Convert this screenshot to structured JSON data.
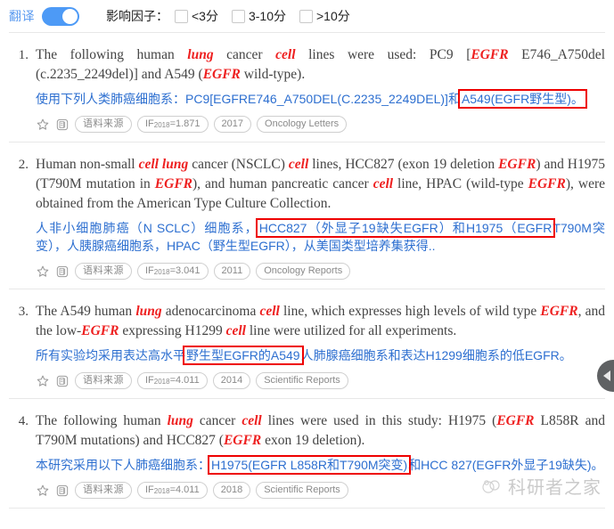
{
  "toolbar": {
    "translate_label": "翻译",
    "translate_on": true,
    "impact_factor_label": "影响因子：",
    "filters": [
      {
        "label": "<3分",
        "checked": false
      },
      {
        "label": "3-10分",
        "checked": false
      },
      {
        "label": ">10分",
        "checked": false
      }
    ]
  },
  "icons": {
    "star": "star-icon",
    "copy": "copy-document-icon",
    "collapse": "chevron-left-icon"
  },
  "chip_labels": {
    "source": "语料来源"
  },
  "colors": {
    "accent_blue": "#4d9af6",
    "translation_blue": "#2d6fd0",
    "keyword_red": "#ee2020",
    "highlight_red": "#ee0000",
    "chip_gray": "#8a8a8a",
    "source_text": "#444444"
  },
  "watermark": {
    "text": "科研者之家"
  },
  "results": [
    {
      "num": "1.",
      "source_parts": [
        {
          "t": "The following human ",
          "kw": false
        },
        {
          "t": "lung",
          "kw": true
        },
        {
          "t": " cancer ",
          "kw": false
        },
        {
          "t": "cell",
          "kw": true
        },
        {
          "t": " lines were used: PC9 [",
          "kw": false
        },
        {
          "t": "EGFR",
          "kw": true
        },
        {
          "t": " E746_A750del (c.2235_2249del)] and A549 (",
          "kw": false
        },
        {
          "t": "EGFR",
          "kw": true
        },
        {
          "t": " wild-type).",
          "kw": false
        }
      ],
      "translation_parts": [
        {
          "t": "使用下列人类肺癌细胞系：PC9[EGFRE746_A750DEL(C.2235_2249DEL)]和",
          "hl": false
        },
        {
          "t": "A549(EGFR野生型)。",
          "hl": true
        }
      ],
      "chips": {
        "impact_prefix": "IF",
        "impact_year": "2018",
        "impact_value": "=1.871",
        "year": "2017",
        "journal": "Oncology Letters"
      }
    },
    {
      "num": "2.",
      "source_parts": [
        {
          "t": "Human non-small ",
          "kw": false
        },
        {
          "t": "cell lung",
          "kw": true
        },
        {
          "t": " cancer (NSCLC) ",
          "kw": false
        },
        {
          "t": "cell",
          "kw": true
        },
        {
          "t": " lines, HCC827 (exon 19 deletion ",
          "kw": false
        },
        {
          "t": "EGFR",
          "kw": true
        },
        {
          "t": ") and H1975 (T790M mutation in ",
          "kw": false
        },
        {
          "t": "EGFR",
          "kw": true
        },
        {
          "t": "), and human pancreatic cancer ",
          "kw": false
        },
        {
          "t": "cell",
          "kw": true
        },
        {
          "t": " line, HPAC (wild-type ",
          "kw": false
        },
        {
          "t": "EGFR",
          "kw": true
        },
        {
          "t": "), were obtained from the American Type Culture Collection.",
          "kw": false
        }
      ],
      "translation_parts": [
        {
          "t": "人非小细胞肺癌（N SCLC）细胞系，",
          "hl": false
        },
        {
          "t": "HCC827（外显子19缺失EGFR）和H1975（EGFR",
          "hl": true
        },
        {
          "t": "T790M突变），人胰腺癌细胞系，HPAC（野生型EGFR），从美国类型培养集获得..",
          "hl": false
        }
      ],
      "chips": {
        "impact_prefix": "IF",
        "impact_year": "2018",
        "impact_value": "=3.041",
        "year": "2011",
        "journal": "Oncology Reports"
      }
    },
    {
      "num": "3.",
      "source_parts": [
        {
          "t": "The A549 human ",
          "kw": false
        },
        {
          "t": "lung",
          "kw": true
        },
        {
          "t": " adenocarcinoma ",
          "kw": false
        },
        {
          "t": "cell",
          "kw": true
        },
        {
          "t": " line, which expresses high levels of wild type ",
          "kw": false
        },
        {
          "t": "EGFR",
          "kw": true
        },
        {
          "t": ", and the low-",
          "kw": false
        },
        {
          "t": "EGFR",
          "kw": true
        },
        {
          "t": " expressing H1299 ",
          "kw": false
        },
        {
          "t": "cell",
          "kw": true
        },
        {
          "t": " line were utilized for all experiments.",
          "kw": false
        }
      ],
      "translation_parts": [
        {
          "t": "所有实验均采用表达高水平",
          "hl": false
        },
        {
          "t": "野生型EGFR的A549",
          "hl": true
        },
        {
          "t": "人肺腺癌细胞系和表达H1299细胞系的低EGFR。",
          "hl": false
        }
      ],
      "chips": {
        "impact_prefix": "IF",
        "impact_year": "2018",
        "impact_value": "=4.011",
        "year": "2014",
        "journal": "Scientific Reports"
      }
    },
    {
      "num": "4.",
      "source_parts": [
        {
          "t": "The following human ",
          "kw": false
        },
        {
          "t": "lung",
          "kw": true
        },
        {
          "t": " cancer ",
          "kw": false
        },
        {
          "t": "cell",
          "kw": true
        },
        {
          "t": " lines were used in this study: H1975 (",
          "kw": false
        },
        {
          "t": "EGFR",
          "kw": true
        },
        {
          "t": " L858R and T790M mutations) and HCC827 (",
          "kw": false
        },
        {
          "t": "EGFR",
          "kw": true
        },
        {
          "t": " exon 19 deletion).",
          "kw": false
        }
      ],
      "translation_parts": [
        {
          "t": "本研究采用以下人肺癌细胞系：",
          "hl": false
        },
        {
          "t": "H1975(EGFR L858R和T790M突变)",
          "hl": true
        },
        {
          "t": "和HCC 827(EGFR外显子19缺失)。",
          "hl": false
        }
      ],
      "chips": {
        "impact_prefix": "IF",
        "impact_year": "2018",
        "impact_value": "=4.011",
        "year": "2018",
        "journal": "Scientific Reports"
      }
    }
  ]
}
